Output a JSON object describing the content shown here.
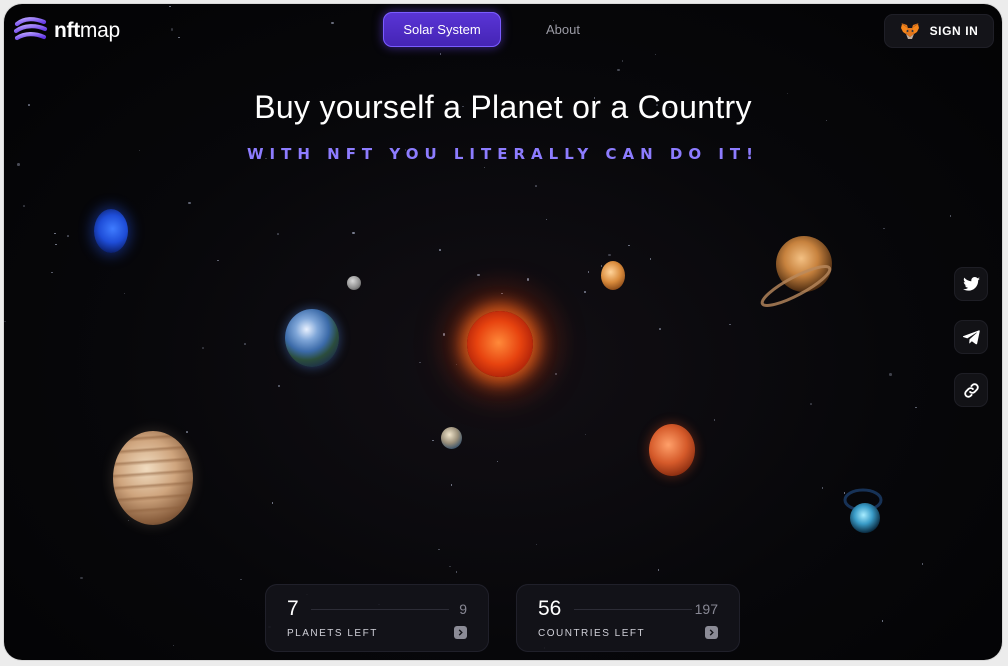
{
  "header": {
    "logo_bold": "nft",
    "logo_light": "map",
    "nav": {
      "active_tab": "Solar System",
      "about": "About"
    },
    "sign_in": "SIGN IN"
  },
  "hero": {
    "title": "Buy yourself a Planet or a Country",
    "subtitle": "WITH NFT YOU LITERALLY CAN DO IT!"
  },
  "socials": [
    "twitter-icon",
    "telegram-icon",
    "link-icon"
  ],
  "stats": [
    {
      "count": "7",
      "total": "9",
      "label": "PLANETS LEFT"
    },
    {
      "count": "56",
      "total": "197",
      "label": "COUNTRIES LEFT"
    }
  ],
  "colors": {
    "accent": "#5a35d6",
    "subtitle": "#8d7cff",
    "background": "#07070a"
  }
}
